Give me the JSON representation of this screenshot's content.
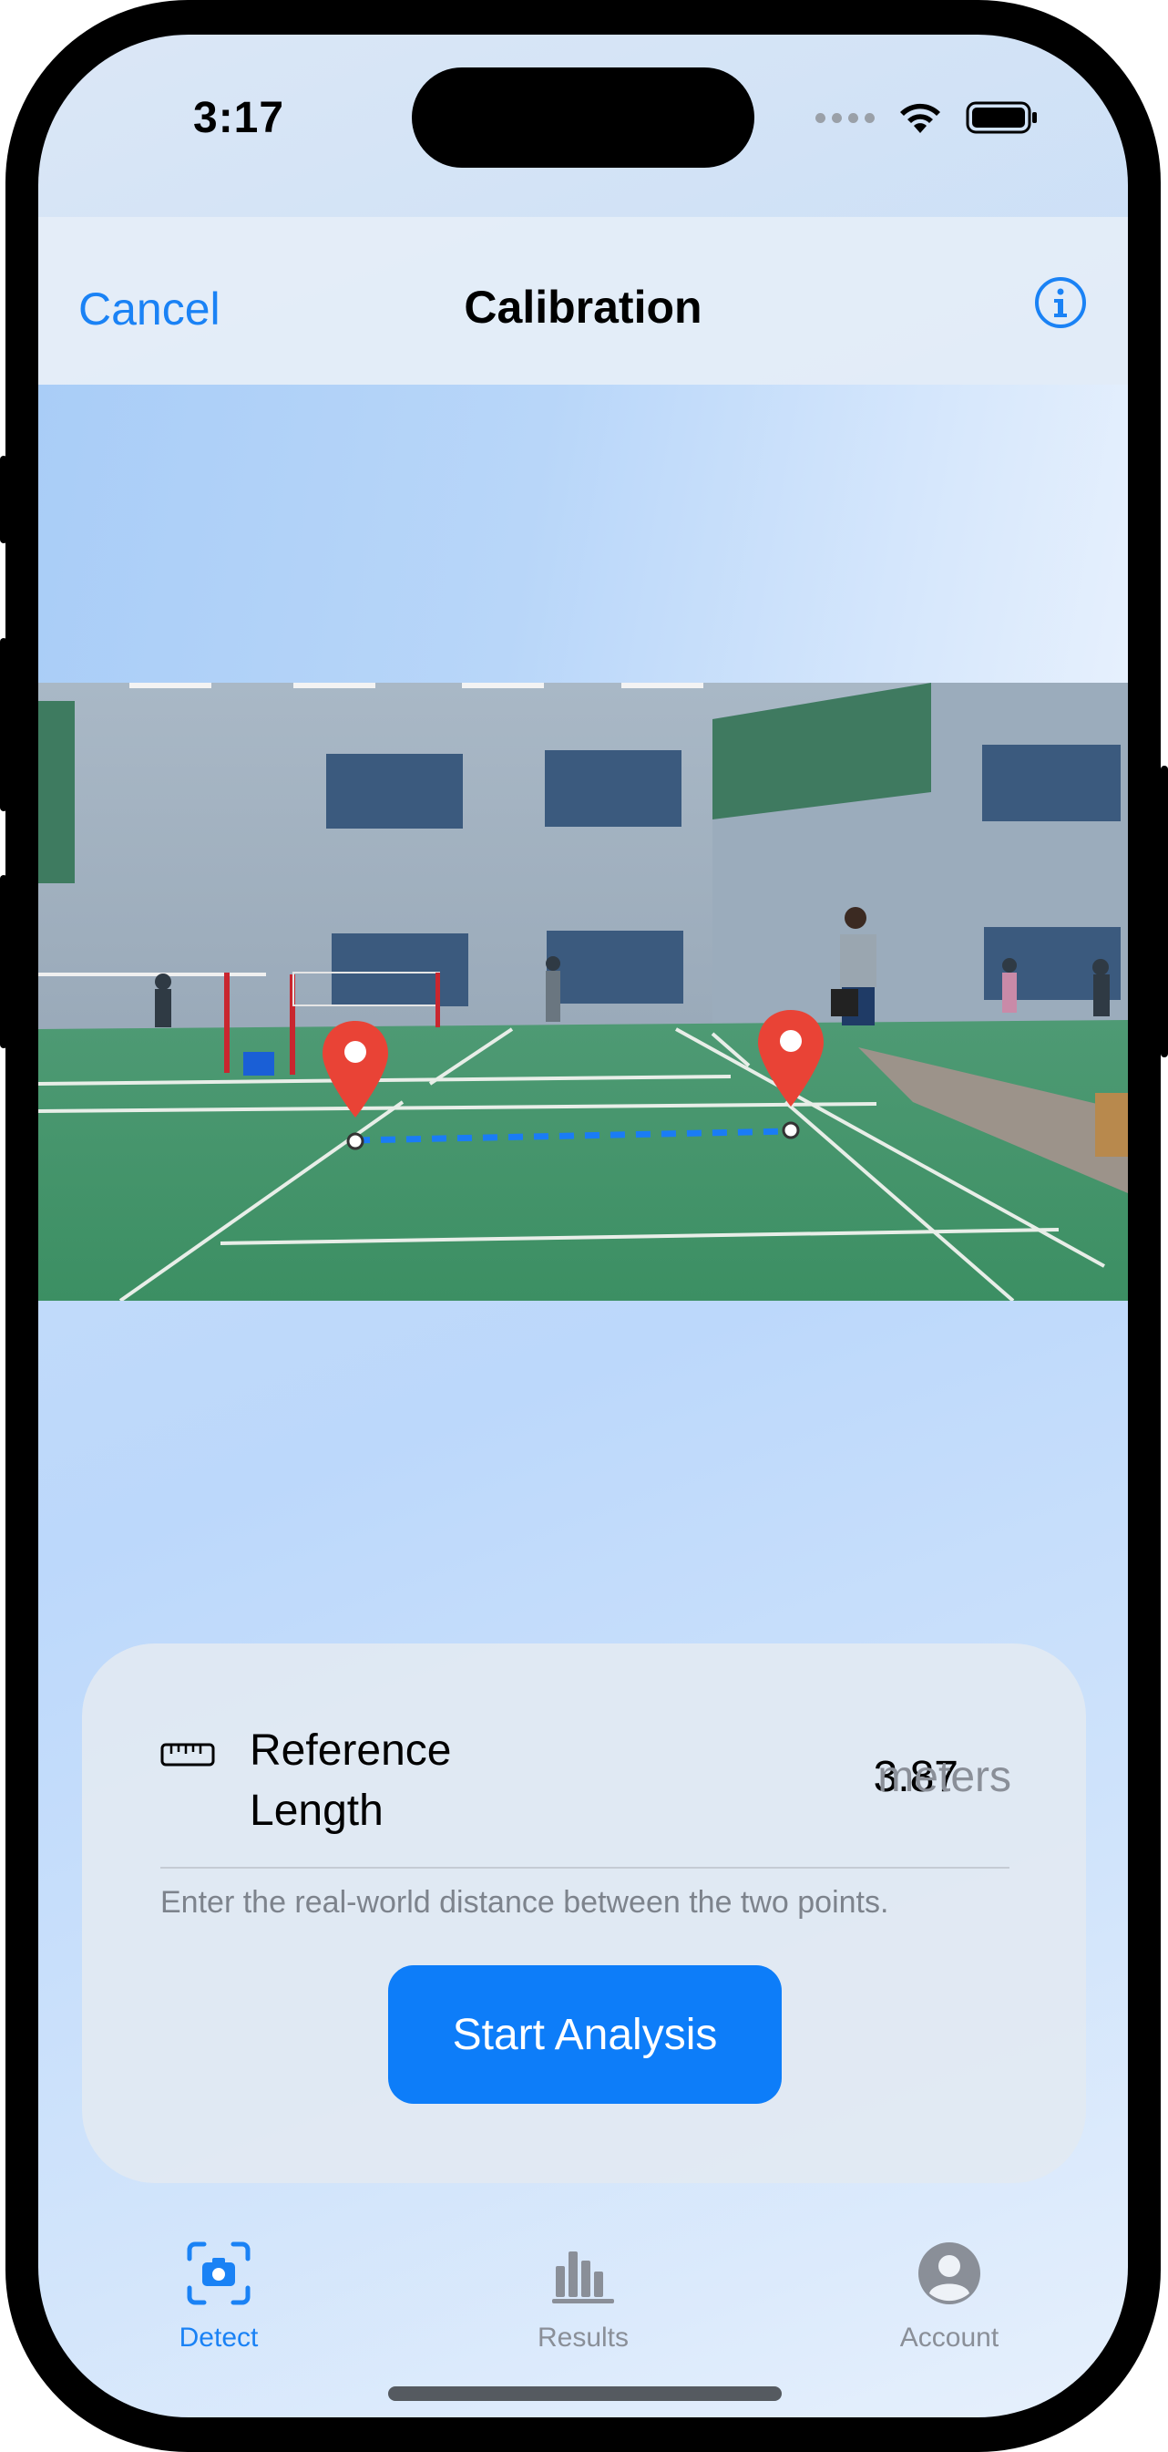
{
  "status_bar": {
    "time": "3:17"
  },
  "nav": {
    "cancel_label": "Cancel",
    "title": "Calibration",
    "info_icon": "info-icon"
  },
  "reference": {
    "label": "Reference Length",
    "value": "3.87",
    "unit": "meters",
    "hint": "Enter the real-world distance between the two points.",
    "icon": "ruler-icon"
  },
  "actions": {
    "start_label": "Start Analysis"
  },
  "tabs": [
    {
      "label": "Detect",
      "icon": "camera-scan-icon",
      "active": true
    },
    {
      "label": "Results",
      "icon": "bar-chart-icon",
      "active": false
    },
    {
      "label": "Account",
      "icon": "person-circle-icon",
      "active": false
    }
  ],
  "colors": {
    "accent": "#1a82f5",
    "pin": "#e94336",
    "line": "#1a7cf5",
    "court": "#3c8f63"
  }
}
